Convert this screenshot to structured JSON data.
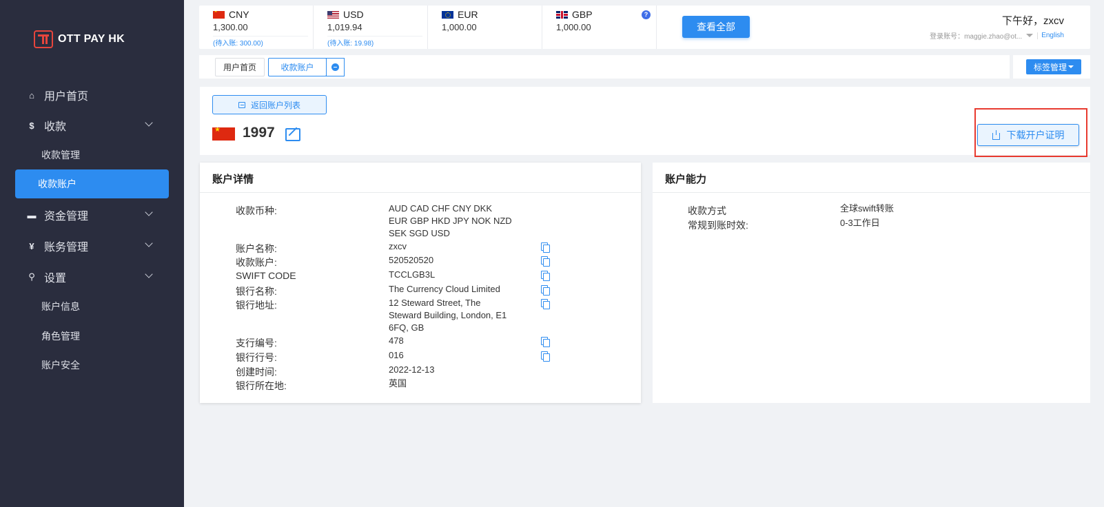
{
  "brand": {
    "name": "OTT PAY HK",
    "accent": "#2d8cf0",
    "highlight": "#e8392e"
  },
  "sidebar": {
    "items": [
      {
        "label": "用户首页",
        "icon": "home-icon"
      },
      {
        "label": "收款",
        "icon": "dollar-icon"
      },
      {
        "label": "收款管理"
      },
      {
        "label": "收款账户"
      },
      {
        "label": "资金管理",
        "icon": "card-icon"
      },
      {
        "label": "账务管理",
        "icon": "yen-icon"
      },
      {
        "label": "设置",
        "icon": "search-icon"
      },
      {
        "label": "账户信息"
      },
      {
        "label": "角色管理"
      },
      {
        "label": "账户安全"
      }
    ]
  },
  "balances": [
    {
      "code": "CNY",
      "amount": "1,300.00",
      "pending": "(待入账: 300.00)"
    },
    {
      "code": "USD",
      "amount": "1,019.94",
      "pending": "(待入账: 19.98)"
    },
    {
      "code": "EUR",
      "amount": "1,000.00"
    },
    {
      "code": "GBP",
      "amount": "1,000.00"
    }
  ],
  "header": {
    "help": "?",
    "view_all": "查看全部",
    "greeting": "下午好，zxcv",
    "login_account": "登录账号：maggie.zhao@ot...",
    "language": "English"
  },
  "tabs": [
    {
      "label": "用户首页"
    },
    {
      "label": "收款账户"
    }
  ],
  "tag_manager": "标签管理",
  "account": {
    "back_label": "返回账户列表",
    "number": "1997",
    "download_label": "下载开户证明"
  },
  "details": {
    "title": "账户详情",
    "rows": [
      {
        "label": "收款币种:",
        "value": "AUD CAD CHF CNY DKK\nEUR GBP HKD JPY NOK NZD\nSEK SGD USD"
      },
      {
        "label": "账户名称:",
        "value": "zxcv"
      },
      {
        "label": "收款账户:",
        "value": "520520520"
      },
      {
        "label": "SWIFT CODE",
        "value": "TCCLGB3L"
      },
      {
        "label": "银行名称:",
        "value": "The Currency Cloud Limited"
      },
      {
        "label": "银行地址:",
        "value": "12 Steward Street, The\nSteward Building, London, E1\n6FQ, GB"
      },
      {
        "label": "支行编号:",
        "value": "478"
      },
      {
        "label": "银行行号:",
        "value": "016"
      },
      {
        "label": "创建时间:",
        "value": "2022-12-13"
      },
      {
        "label": "银行所在地:",
        "value": "英国"
      }
    ]
  },
  "capabilities": {
    "title": "账户能力",
    "rows": [
      {
        "label": "收款方式",
        "value": "全球swift转账"
      },
      {
        "label": "常规到账时效:",
        "value": "0-3工作日"
      }
    ]
  }
}
